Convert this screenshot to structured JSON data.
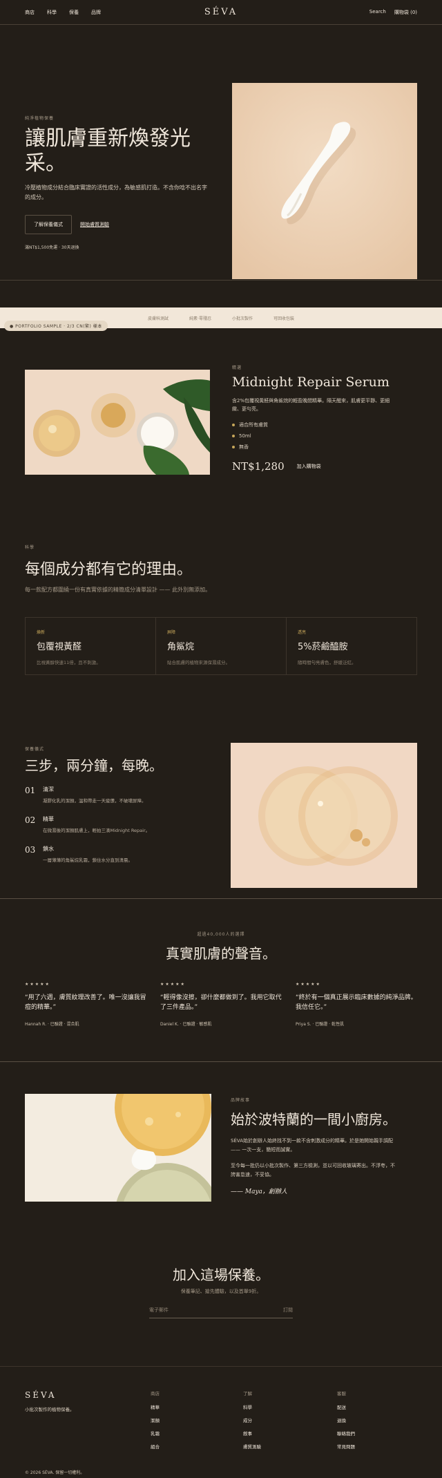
{
  "nav": {
    "links": [
      "商店",
      "科學",
      "保養",
      "品牌"
    ],
    "brand": "SÉVA",
    "search": "Search",
    "cart": "購物袋 (0)"
  },
  "hero": {
    "eyebrow": "純淨植物保養",
    "title": "讓肌膚重新煥發光采。",
    "lead": "冷壓植物成分結合臨床實證的活性成分，為敏感肌打造。不含你唸不出名字的成分。",
    "primary_btn": "了解保養儀式",
    "secondary_link": "開始膚質測驗",
    "shipping": "滿NT$1,500免運 · 30天退換"
  },
  "strip": {
    "items": [
      "皮膚科測試",
      "純素·零殘忍",
      "小批次製作",
      "可回收包裝"
    ]
  },
  "sample_badge": "● PORTFOLIO SAMPLE · 2/3 CN(繁) 樣本",
  "product": {
    "eyebrow": "精選",
    "name": "Midnight Repair Serum",
    "desc": "含2%包覆視黃醛與角鯊烷的輕盈晚間精華。隔天醒來，肌膚更平靜、更細緻、更勻亮。",
    "bullets": [
      "適合所有膚質",
      "50ml",
      "無香"
    ],
    "price": "NT$1,280",
    "add": "加入購物袋"
  },
  "ingredients": {
    "eyebrow": "科學",
    "title": "每個成分都有它的理由。",
    "sub": "每一款配方都圍繞一份有真實依據的精簡成分清單設計 —— 此外別無添加。",
    "cards": [
      {
        "tag": "煥新",
        "name": "包覆視黃醛",
        "body": "比視黃醇快速11倍，且不刺激。"
      },
      {
        "tag": "屏障",
        "name": "角鯊烷",
        "body": "貼合肌膚的植物來源保濕成分。"
      },
      {
        "tag": "透亮",
        "name": "5%菸鹼醯胺",
        "body": "隨時間勻亮膚色，舒緩泛紅。"
      }
    ]
  },
  "ritual": {
    "eyebrow": "保養儀式",
    "title": "三步，兩分鐘，每晚。",
    "steps": [
      {
        "n": "01",
        "t": "清潔",
        "d": "凝膠化乳的潔顏，溫和帶走一天疲憊，不破壞屏障。"
      },
      {
        "n": "02",
        "t": "精華",
        "d": "在微濕後的潔顏肌膚上，輕拍三滴Midnight Repair。"
      },
      {
        "n": "03",
        "t": "鎖水",
        "d": "一層薄薄的角鯊烷乳霜，鎖住水分直到清晨。"
      }
    ]
  },
  "reviews": {
    "eyebrow": "超過40,000人的選擇",
    "title": "真實肌膚的聲音。",
    "items": [
      {
        "stars": "★★★★★",
        "quote": "“用了六週，膚質紋理改善了。唯一沒讓我冒痘的精華。”",
        "who": "Hannah R. · 已驗證 · 混合肌"
      },
      {
        "stars": "★★★★★",
        "quote": "“輕得像沒擦，卻什麼都做到了。我用它取代了三件產品。”",
        "who": "Daniel K. · 已驗證 · 敏感肌"
      },
      {
        "stars": "★★★★★",
        "quote": "“終於有一個真正展示臨床數據的純淨品牌。我信任它。”",
        "who": "Priya S. · 已驗證 · 乾性肌"
      }
    ]
  },
  "story": {
    "eyebrow": "品牌故事",
    "title": "始於波特蘭的一間小廚房。",
    "p1": "SÉVA始於創辦人始終找不到一款不含刺激成分的精華。於是她開始親手調配 —— 一次一支，簡短而誠實。",
    "p2": "至今每一批仍以小批次製作、第三方檢測，並以可回收玻璃寄出。不浮夸，不誇害怠速，不妥協。",
    "sig": "—— Maya，創辦人"
  },
  "newsletter": {
    "title": "加入這場保養。",
    "sub": "保養筆記、搶先體驗，以及首單9折。",
    "placeholder": "電子郵件",
    "submit": "訂閱"
  },
  "footer": {
    "brand": "SÉVA",
    "tagline": "小批次製作的植物保養。",
    "cols": [
      {
        "h": "商店",
        "items": [
          "精華",
          "潔顏",
          "乳霜",
          "組合"
        ]
      },
      {
        "h": "了解",
        "items": [
          "科學",
          "成分",
          "敘事",
          "膚質測驗"
        ]
      },
      {
        "h": "客服",
        "items": [
          "配送",
          "退換",
          "聯絡我們",
          "常見問題"
        ]
      }
    ],
    "copyright": "© 2026 SÉVA. 保留一切權利。"
  },
  "colors": {
    "bg": "#231e18",
    "accent": "#c7a75a",
    "cream": "#f2e7d9"
  }
}
